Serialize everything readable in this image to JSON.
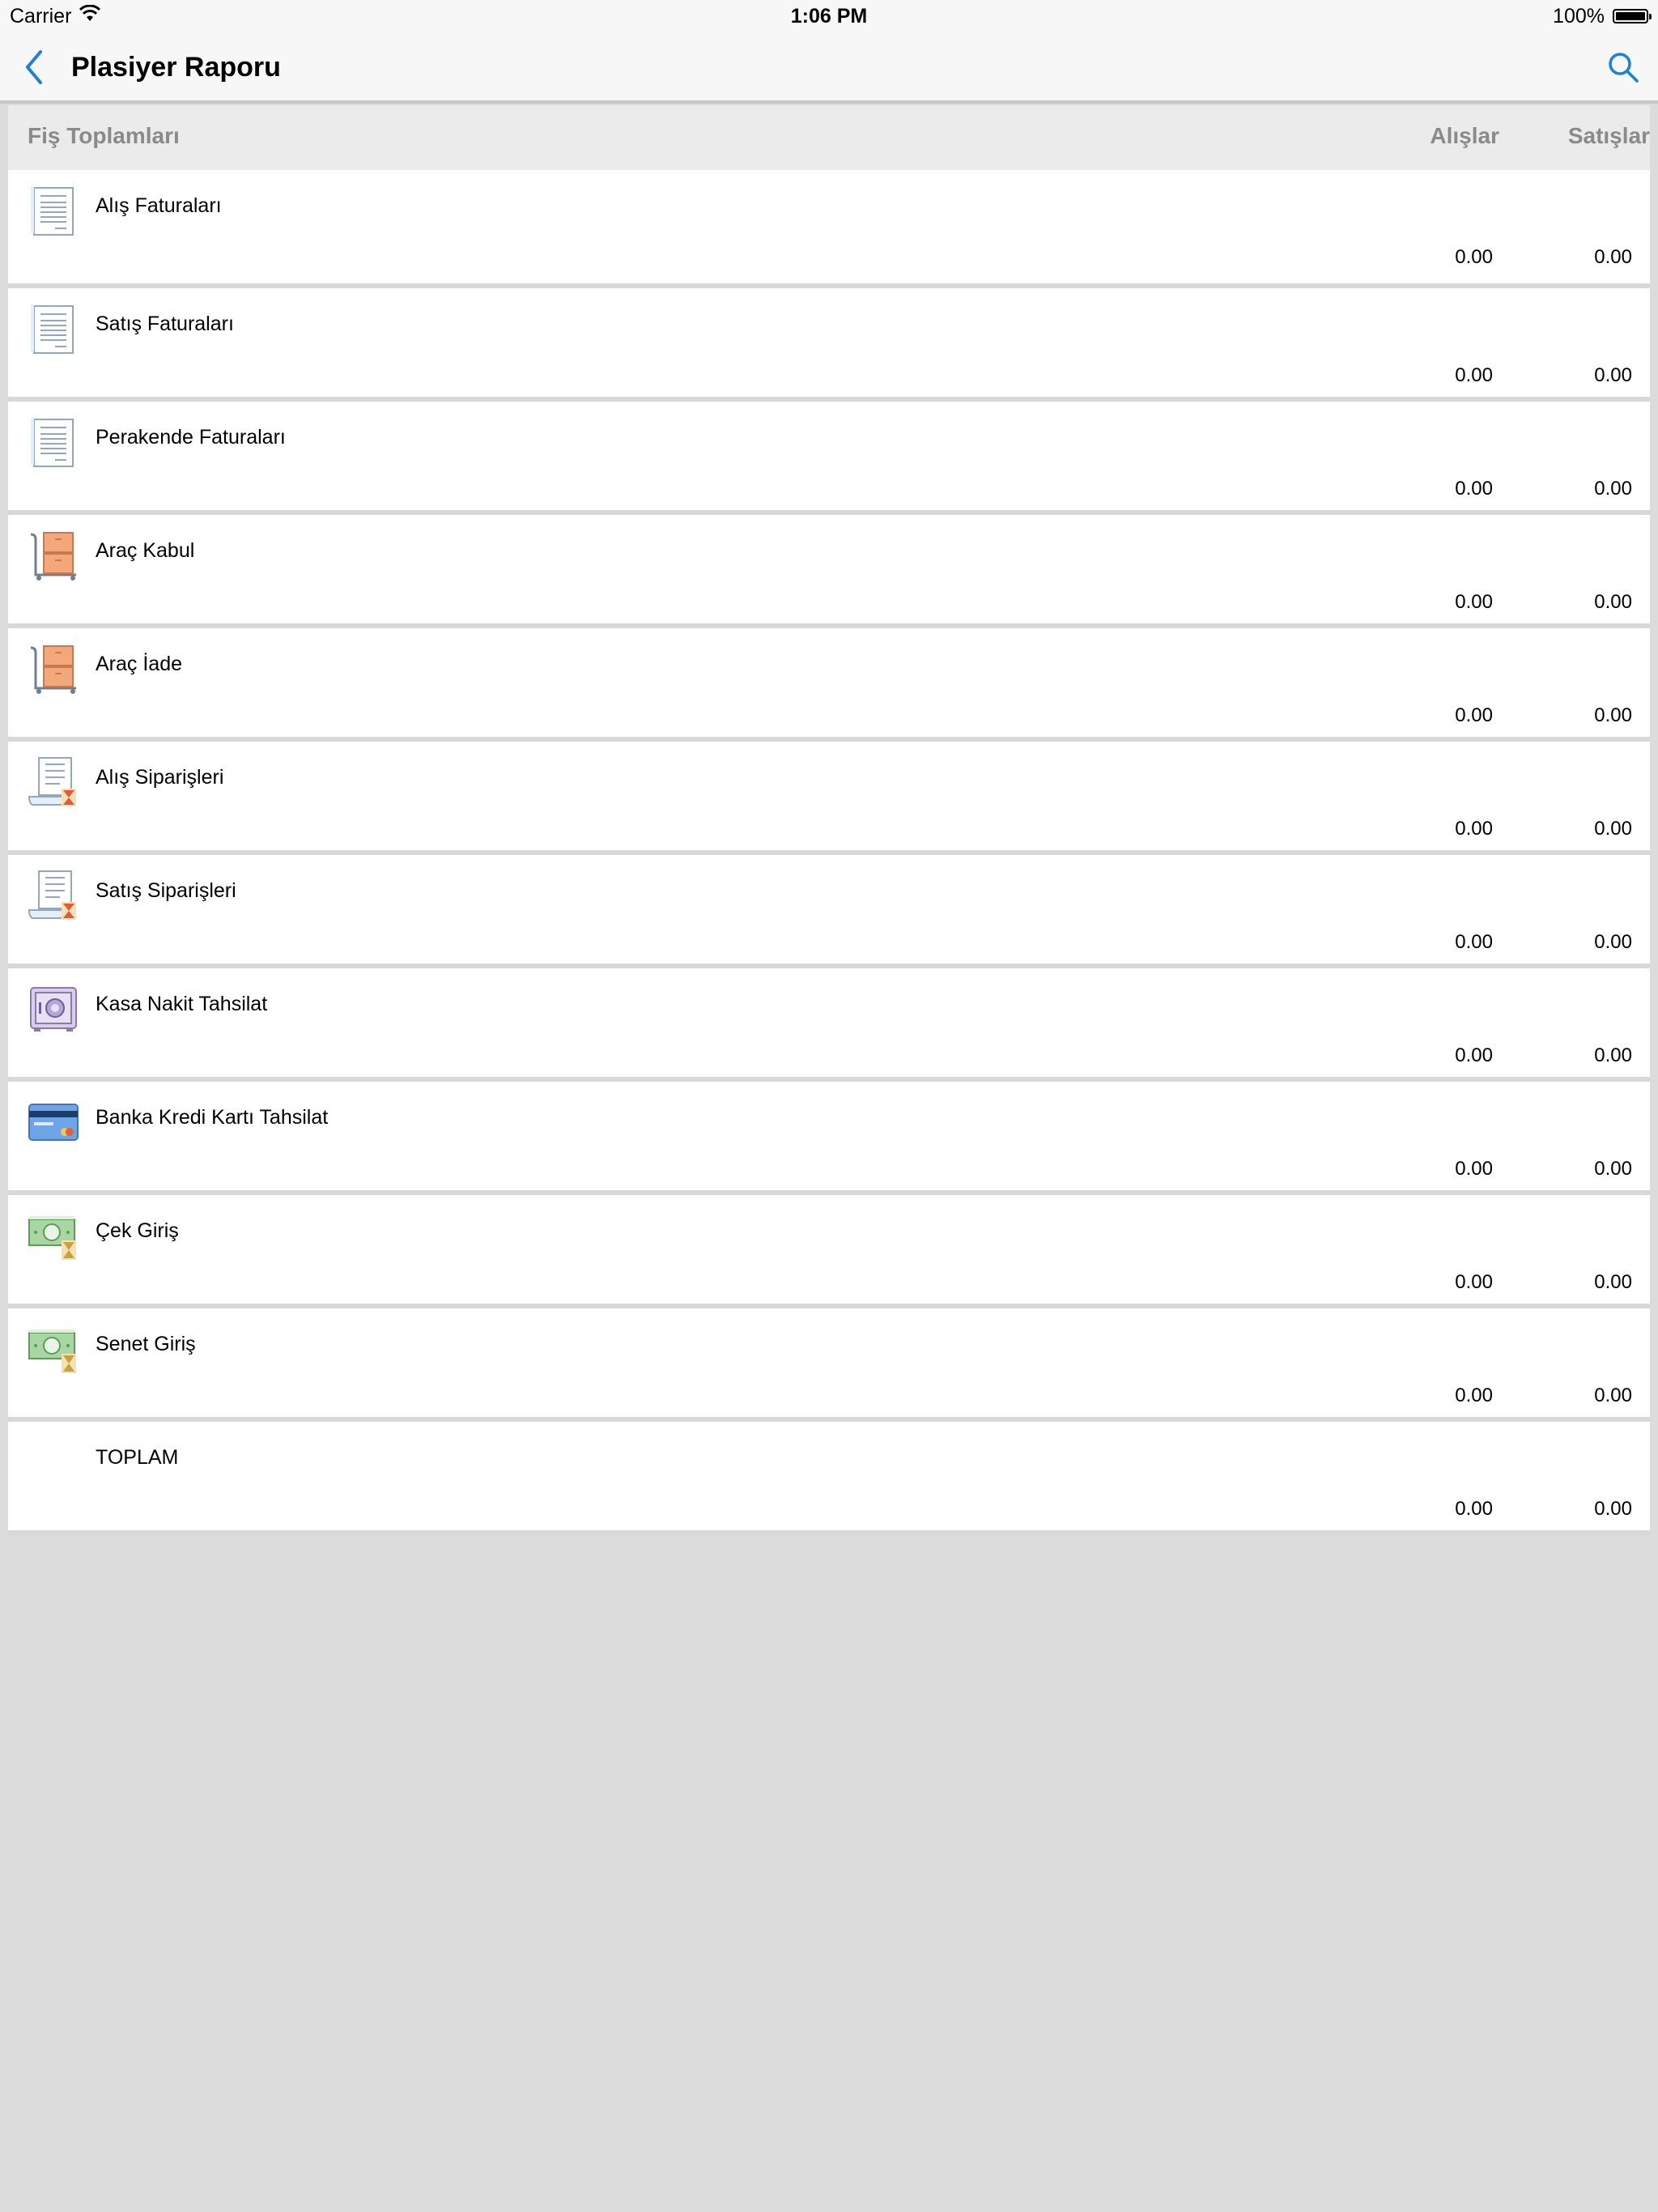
{
  "status_bar": {
    "carrier": "Carrier",
    "time": "1:06 PM",
    "battery": "100%"
  },
  "nav": {
    "title": "Plasiyer Raporu"
  },
  "table": {
    "header": {
      "title": "Fiş Toplamları",
      "buy": "Alışlar",
      "sell": "Satışlar"
    },
    "rows": [
      {
        "label": "Alış Faturaları",
        "icon": "invoice-icon",
        "buy": "0.00",
        "sell": "0.00"
      },
      {
        "label": "Satış Faturaları",
        "icon": "invoice-icon",
        "buy": "0.00",
        "sell": "0.00"
      },
      {
        "label": "Perakende Faturaları",
        "icon": "invoice-icon",
        "buy": "0.00",
        "sell": "0.00"
      },
      {
        "label": "Araç Kabul",
        "icon": "cart-boxes-icon",
        "buy": "0.00",
        "sell": "0.00"
      },
      {
        "label": "Araç İade",
        "icon": "cart-boxes-icon",
        "buy": "0.00",
        "sell": "0.00"
      },
      {
        "label": "Alış Siparişleri",
        "icon": "order-hourglass-icon",
        "buy": "0.00",
        "sell": "0.00"
      },
      {
        "label": "Satış Siparişleri",
        "icon": "order-hourglass-icon",
        "buy": "0.00",
        "sell": "0.00"
      },
      {
        "label": "Kasa Nakit Tahsilat",
        "icon": "safe-icon",
        "buy": "0.00",
        "sell": "0.00"
      },
      {
        "label": "Banka Kredi Kartı Tahsilat",
        "icon": "credit-card-icon",
        "buy": "0.00",
        "sell": "0.00"
      },
      {
        "label": "Çek Giriş",
        "icon": "banknote-hourglass-icon",
        "buy": "0.00",
        "sell": "0.00"
      },
      {
        "label": "Senet Giriş",
        "icon": "banknote-hourglass-icon",
        "buy": "0.00",
        "sell": "0.00"
      },
      {
        "label": "TOPLAM",
        "icon": "",
        "buy": "0.00",
        "sell": "0.00"
      }
    ]
  },
  "colors": {
    "accent": "#1a7fe0",
    "background": "#dcdcdc",
    "header_bg": "#ebebeb"
  }
}
